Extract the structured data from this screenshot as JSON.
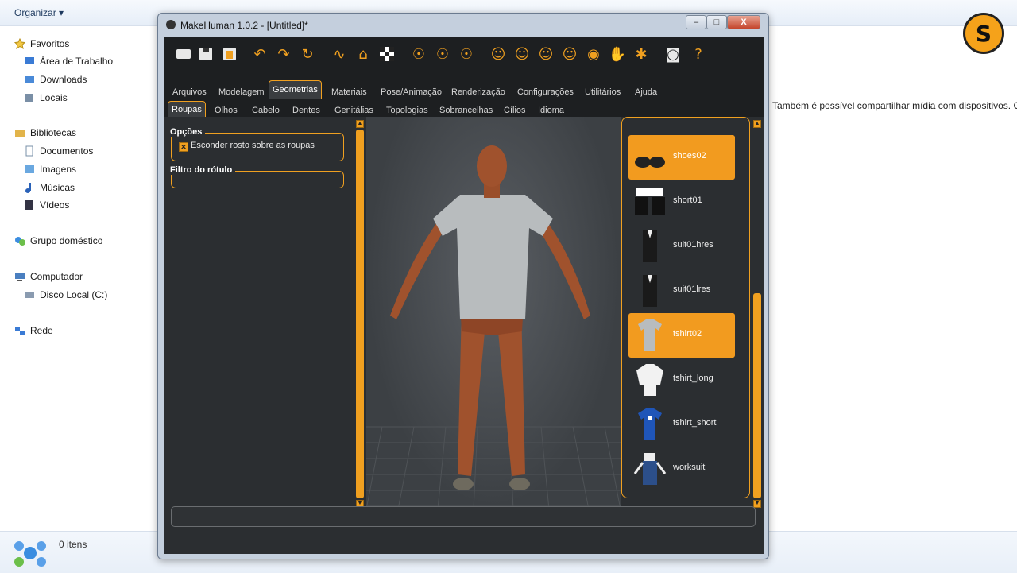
{
  "explorer": {
    "organize": "Organizar ▾",
    "nav": {
      "favorites": "Favoritos",
      "desktop": "Área de Trabalho",
      "downloads": "Downloads",
      "places": "Locais",
      "libraries": "Bibliotecas",
      "documents": "Documentos",
      "images": "Imagens",
      "music": "Músicas",
      "videos": "Vídeos",
      "homegroup": "Grupo doméstico",
      "computer": "Computador",
      "local_disk": "Disco Local (C:)",
      "network": "Rede"
    },
    "right_text": "Também é possível compartilhar mídia com dispositivos. O",
    "status": "0 itens",
    "logo_letter": "S"
  },
  "window": {
    "title": "MakeHuman 1.0.2 - [Untitled]*",
    "controls": {
      "minimize": "–",
      "maximize": "□",
      "close": "X"
    }
  },
  "toolbar_icons": [
    "new-icon",
    "save-icon",
    "export-icon",
    "undo-icon",
    "redo-icon",
    "reset-icon",
    "smooth-icon",
    "wireframe-icon",
    "background-icon",
    "pose-icon",
    "skeleton-icon",
    "symmetry-icon",
    "front-view-icon",
    "back-view-icon",
    "left-view-icon",
    "right-view-icon",
    "top-view-icon",
    "bottom-view-icon",
    "reset-camera-icon",
    "screenshot-icon",
    "help-icon"
  ],
  "tabs": [
    {
      "label": "Arquivos",
      "active": false
    },
    {
      "label": "Modelagem",
      "active": false
    },
    {
      "label": "Geometrias",
      "active": true
    },
    {
      "label": "Materiais",
      "active": false
    },
    {
      "label": "Pose/Animação",
      "active": false
    },
    {
      "label": "Renderização",
      "active": false
    },
    {
      "label": "Configurações",
      "active": false
    },
    {
      "label": "Utilitários",
      "active": false
    },
    {
      "label": "Ajuda",
      "active": false
    }
  ],
  "subtabs": [
    {
      "label": "Roupas",
      "active": true
    },
    {
      "label": "Olhos",
      "active": false
    },
    {
      "label": "Cabelo",
      "active": false
    },
    {
      "label": "Dentes",
      "active": false
    },
    {
      "label": "Genitálias",
      "active": false
    },
    {
      "label": "Topologias",
      "active": false
    },
    {
      "label": "Sobrancelhas",
      "active": false
    },
    {
      "label": "Cílios",
      "active": false
    },
    {
      "label": "Idioma",
      "active": false
    }
  ],
  "left_panel": {
    "options_title": "Opções",
    "hide_face_label": "Esconder rosto sobre as roupas",
    "hide_face_checked": true,
    "filter_title": "Filtro do rótulo"
  },
  "clothes": [
    {
      "label": "shoes02",
      "selected": true
    },
    {
      "label": "short01",
      "selected": false
    },
    {
      "label": "suit01hres",
      "selected": false
    },
    {
      "label": "suit01lres",
      "selected": false
    },
    {
      "label": "tshirt02",
      "selected": true
    },
    {
      "label": "tshirt_long",
      "selected": false
    },
    {
      "label": "tshirt_short",
      "selected": false
    },
    {
      "label": "worksuit",
      "selected": false
    }
  ],
  "colors": {
    "accent": "#f0a020",
    "panel": "#2b2e31",
    "dark": "#1d1f21",
    "skin": "#a0522d",
    "shirt": "#b8bcbe"
  }
}
